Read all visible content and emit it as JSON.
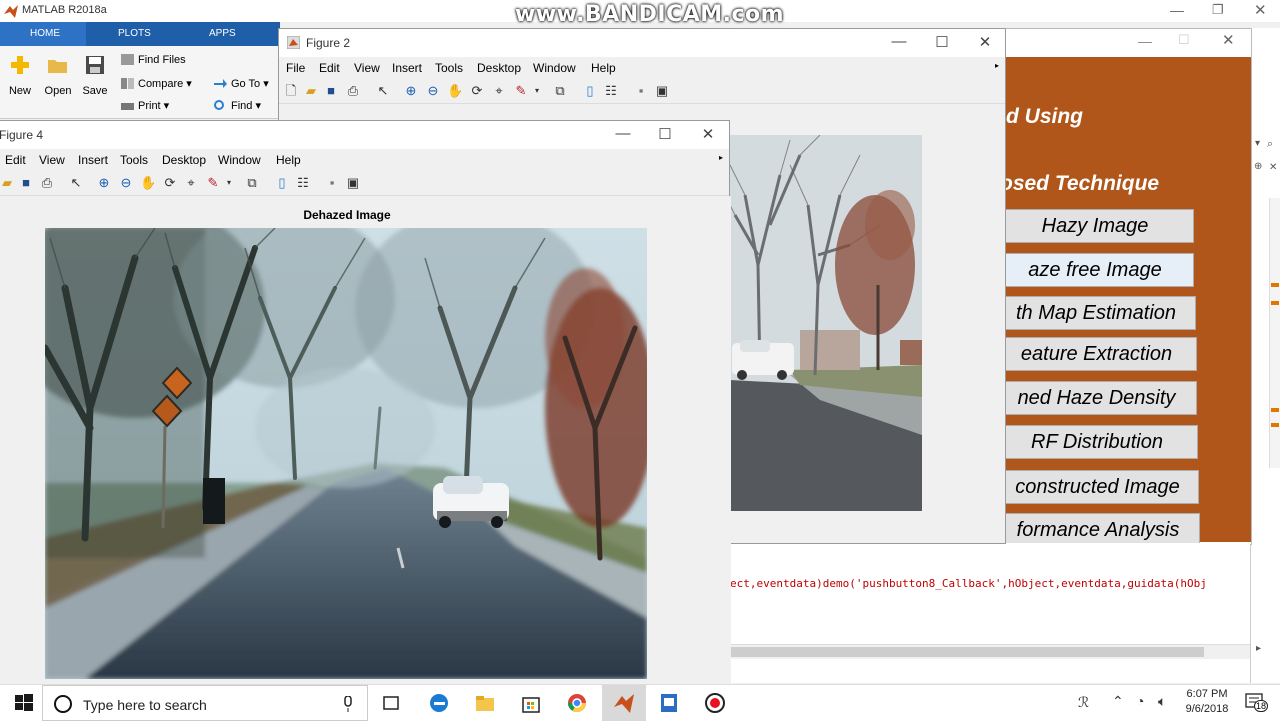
{
  "matlab": {
    "title": "MATLAB R2018a",
    "tabs": [
      "HOME",
      "PLOTS",
      "APPS"
    ],
    "buttons": {
      "new": "New",
      "open": "Open",
      "save": "Save",
      "find_files": "Find Files",
      "compare": "Compare",
      "print": "Print",
      "go_to": "Go To",
      "find": "Find"
    }
  },
  "watermark": "www.BANDICAM.com",
  "figure2": {
    "title": "Figure 2",
    "menu": [
      "File",
      "Edit",
      "View",
      "Insert",
      "Tools",
      "Desktop",
      "Window",
      "Help"
    ]
  },
  "figure4": {
    "title": "Figure 4",
    "menu": [
      "Edit",
      "View",
      "Insert",
      "Tools",
      "Desktop",
      "Window",
      "Help"
    ],
    "axes_title": "Dehazed Image"
  },
  "gui": {
    "heading1": "d Using",
    "heading2": "osed Technique",
    "buttons": [
      "Hazy Image",
      "aze free Image",
      "th Map Estimation",
      "eature Extraction",
      "ned Haze Density",
      "RF Distribution",
      "constructed Image",
      "formance Analysis"
    ]
  },
  "command": {
    "line": "ect,eventdata)demo('pushbutton8_Callback',hObject,eventdata,guidata(hObj"
  },
  "taskbar": {
    "search_placeholder": "Type here to search",
    "time": "6:07 PM",
    "date": "9/6/2018",
    "notification_count": "18"
  },
  "colors": {
    "gui_panel": "#b1561a",
    "ribbon_blue": "#1f5ea8",
    "command_red": "#c00000"
  }
}
